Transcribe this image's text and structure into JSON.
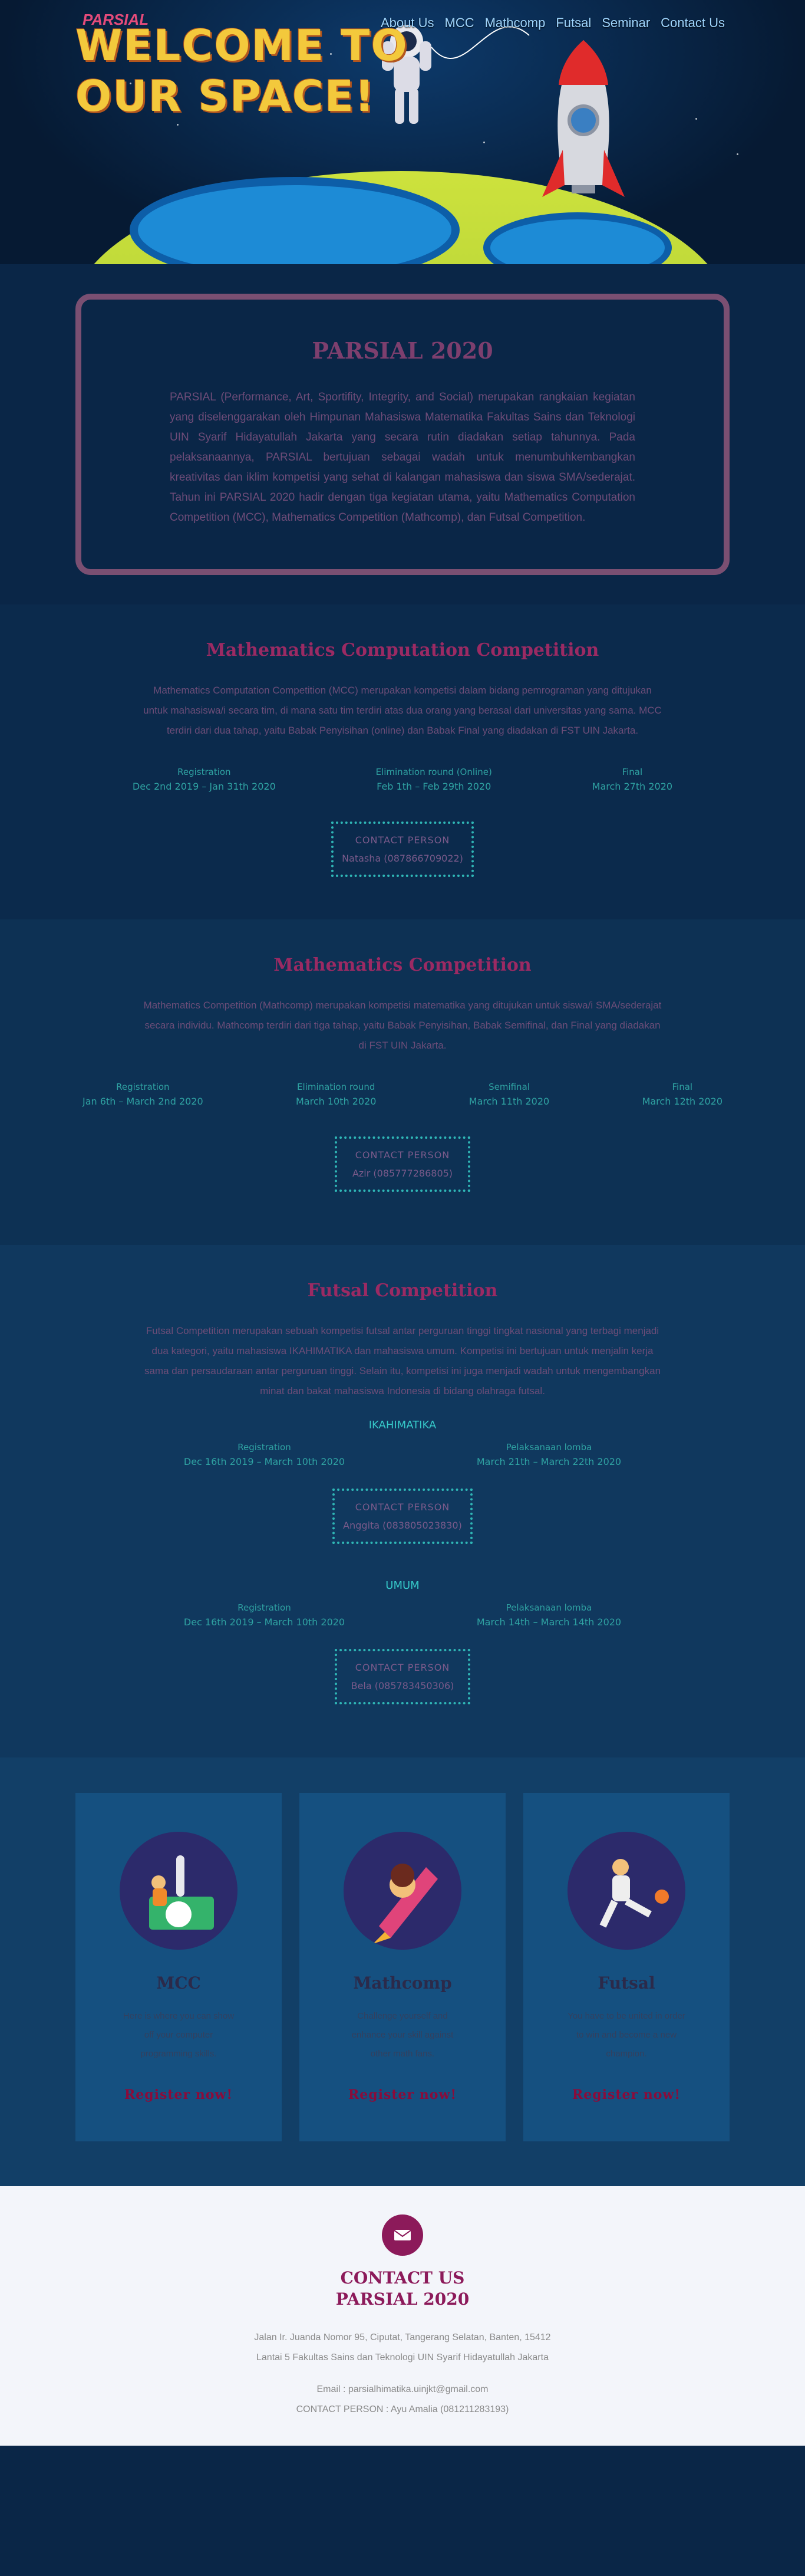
{
  "nav": {
    "logo": "PARSIAL",
    "items": [
      "About Us",
      "MCC",
      "Mathcomp",
      "Futsal",
      "Seminar",
      "Contact Us"
    ]
  },
  "hero": {
    "line1": "WELCOME TO",
    "line2": "OUR SPACE!"
  },
  "about": {
    "title": "PARSIAL 2020",
    "text": "PARSIAL (Performance, Art, Sportifity, Integrity, and Social) merupakan rangkaian kegiatan yang diselenggarakan oleh Himpunan Mahasiswa Matematika Fakultas Sains dan Teknologi UIN Syarif Hidayatullah Jakarta yang secara rutin diadakan setiap tahunnya. Pada pelaksanaannya, PARSIAL bertujuan sebagai wadah untuk menumbuhkembangkan kreativitas dan iklim kompetisi yang sehat di kalangan mahasiswa dan siswa SMA/sederajat. Tahun ini PARSIAL 2020 hadir dengan tiga kegiatan utama, yaitu Mathematics Computation Competition (MCC), Mathematics Competition (Mathcomp), dan Futsal Competition."
  },
  "mcc": {
    "title": "Mathematics Computation Competition",
    "desc": "Mathematics Computation Competition (MCC) merupakan kompetisi dalam bidang pemrograman yang ditujukan untuk mahasiswa/i secara tim, di mana satu tim terdiri atas dua orang yang berasal dari universitas yang sama. MCC terdiri dari dua tahap, yaitu Babak Penyisihan (online) dan Babak Final yang diadakan di FST UIN Jakarta.",
    "stages": [
      {
        "label": "Registration",
        "date": "Dec 2nd 2019 – Jan 31th 2020"
      },
      {
        "label": "Elimination round (Online)",
        "date": "Feb 1th – Feb 29th 2020"
      },
      {
        "label": "Final",
        "date": "March 27th 2020"
      }
    ],
    "contact_label": "CONTACT PERSON",
    "contact_name": "Natasha (087866709022)"
  },
  "mathcomp": {
    "title": "Mathematics Competition",
    "desc": "Mathematics Competition (Mathcomp) merupakan kompetisi matematika yang ditujukan untuk siswa/i SMA/sederajat secara individu. Mathcomp terdiri dari tiga tahap, yaitu Babak Penyisihan, Babak Semifinal, dan Final yang diadakan di FST UIN Jakarta.",
    "stages": [
      {
        "label": "Registration",
        "date": "Jan 6th – March 2nd 2020"
      },
      {
        "label": "Elimination round",
        "date": "March 10th 2020"
      },
      {
        "label": "Semifinal",
        "date": "March 11th 2020"
      },
      {
        "label": "Final",
        "date": "March 12th 2020"
      }
    ],
    "contact_label": "CONTACT PERSON",
    "contact_name": "Azir (085777286805)"
  },
  "futsal": {
    "title": "Futsal Competition",
    "desc": "Futsal Competition merupakan sebuah kompetisi futsal antar perguruan tinggi tingkat nasional yang terbagi menjadi dua kategori, yaitu mahasiswa IKAHIMATIKA dan mahasiswa umum. Kompetisi ini bertujuan untuk menjalin kerja sama dan persaudaraan antar perguruan tinggi. Selain itu, kompetisi ini juga menjadi wadah untuk mengembangkan minat dan bakat mahasiswa Indonesia di bidang olahraga futsal.",
    "categories": [
      {
        "name": "IKAHIMATIKA",
        "stages": [
          {
            "label": "Registration",
            "date": "Dec 16th 2019 – March 10th 2020"
          },
          {
            "label": "Pelaksanaan lomba",
            "date": "March 21th – March 22th 2020"
          }
        ],
        "contact_label": "CONTACT PERSON",
        "contact_name": "Anggita (083805023830)"
      },
      {
        "name": "UMUM",
        "stages": [
          {
            "label": "Registration",
            "date": "Dec 16th 2019 – March 10th 2020"
          },
          {
            "label": "Pelaksanaan lomba",
            "date": "March 14th – March 14th 2020"
          }
        ],
        "contact_label": "CONTACT PERSON",
        "contact_name": "Bela (085783450306)"
      }
    ]
  },
  "cards": [
    {
      "title": "MCC",
      "text": "Here is where you can show off your computer programming skills.",
      "button": "Register now!"
    },
    {
      "title": "Mathcomp",
      "text": "Challenge yourself and enhance your skill against other math fans.",
      "button": "Register now!"
    },
    {
      "title": "Futsal",
      "text": "You have to be united in order to win and become a new champion.",
      "button": "Register now!"
    }
  ],
  "footer": {
    "title1": "CONTACT US",
    "title2": "PARSIAL 2020",
    "address1": "Jalan Ir. Juanda Nomor 95, Ciputat, Tangerang Selatan, Banten, 15412",
    "address2": "Lantai 5 Fakultas Sains dan Teknologi UIN Syarif Hidayatullah Jakarta",
    "email": "Email : parsialhimatika.uinjkt@gmail.com",
    "cp": "CONTACT PERSON : Ayu Amalia (081211283193)"
  },
  "colors": {
    "accent": "#9b2a63",
    "teal": "#2fb5b5",
    "footer_bg": "#f3f5fa"
  }
}
